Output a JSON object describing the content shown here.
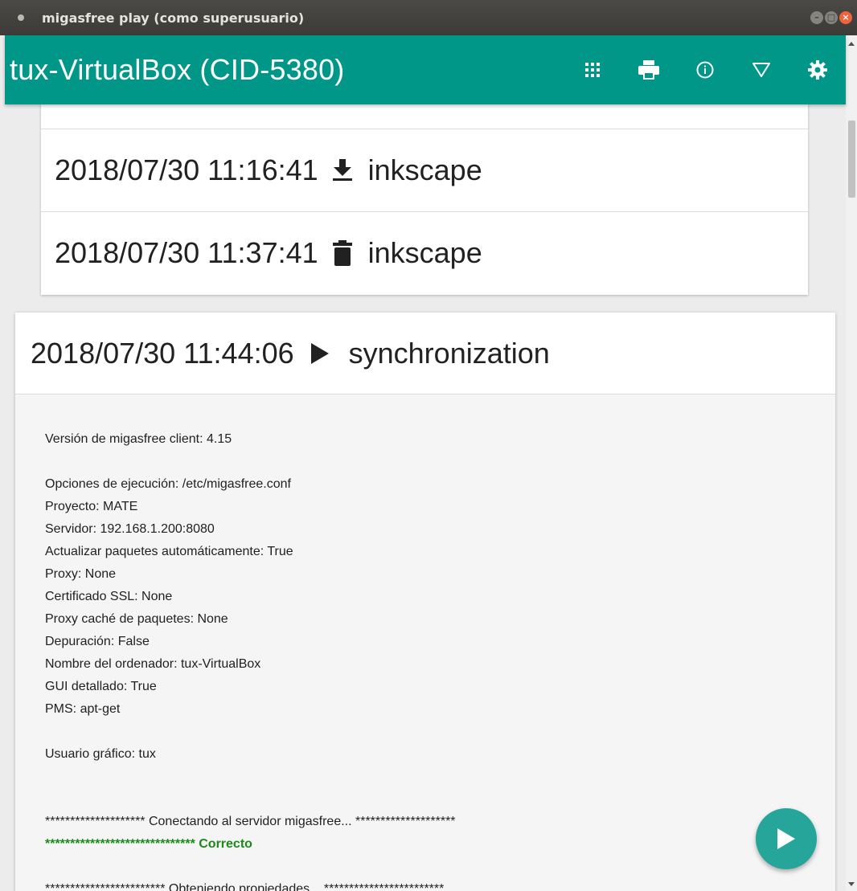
{
  "window": {
    "title": "migasfree play (como superusuario)"
  },
  "appbar": {
    "title": "tux-VirtualBox (CID-5380)",
    "icons": [
      "apps-icon",
      "print-icon",
      "info-icon",
      "filter-icon",
      "settings-icon"
    ]
  },
  "history": [
    {
      "datetime": "2018/07/30 11:16:41",
      "action_icon": "download-icon",
      "name": "inkscape"
    },
    {
      "datetime": "2018/07/30 11:37:41",
      "action_icon": "trash-icon",
      "name": "inkscape"
    }
  ],
  "sync": {
    "datetime": "2018/07/30 11:44:06",
    "action_icon": "play-icon",
    "name": "synchronization",
    "log": [
      "Versión de migasfree client: 4.15",
      "",
      "Opciones de ejecución: /etc/migasfree.conf",
      "Proyecto: MATE",
      "Servidor: 192.168.1.200:8080",
      "Actualizar paquetes automáticamente: True",
      "Proxy: None",
      "Certificado SSL: None",
      "Proxy caché de paquetes: None",
      "Depuración: False",
      "Nombre del ordenador: tux-VirtualBox",
      "GUI detallado: True",
      "PMS: apt-get",
      "",
      "Usuario gráfico: tux",
      "",
      "",
      "******************** Conectando al servidor migasfree... ********************"
    ],
    "ok_line": "****************************** Correcto",
    "log_after": [
      "",
      "************************ Obteniendo propiedades... ************************"
    ]
  },
  "colors": {
    "appbar": "#009688",
    "fab": "#26a69a",
    "ok": "#1b8a1b"
  }
}
